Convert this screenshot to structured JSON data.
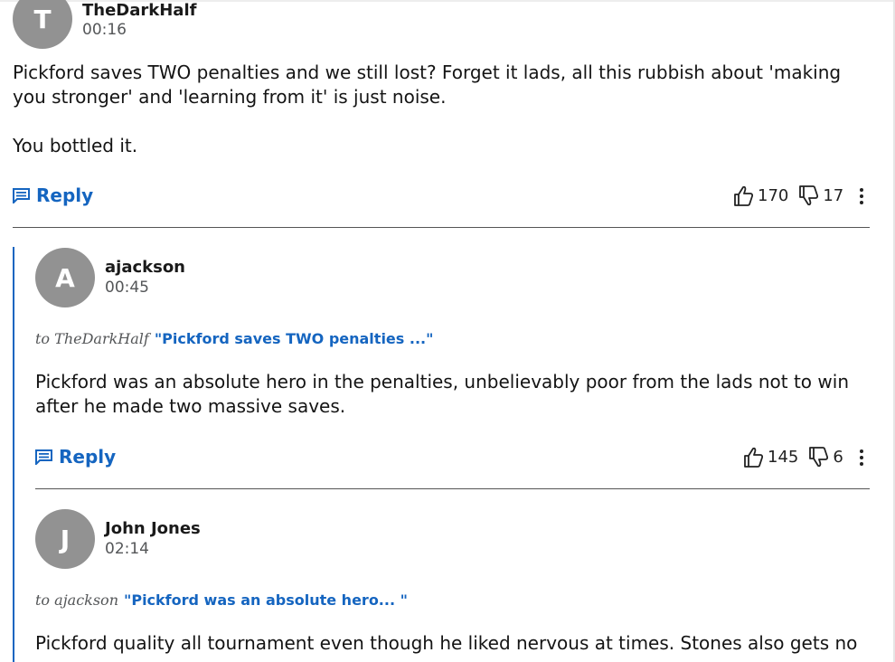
{
  "comments": [
    {
      "avatar_letter": "T",
      "username": "TheDarkHalf",
      "time": "00:16",
      "body": [
        "Pickford saves TWO penalties and we still lost? Forget it lads, all this rubbish about 'making you stronger' and 'learning from it' is just noise.",
        "You bottled it."
      ],
      "reply_label": "Reply",
      "upvotes": "170",
      "downvotes": "17"
    },
    {
      "avatar_letter": "A",
      "username": "ajackson",
      "time": "00:45",
      "reply_to_label": "to TheDarkHalf",
      "reply_to_quote": "\"Pickford saves TWO penalties ...\"",
      "body": [
        "Pickford was an absolute hero in the penalties, unbelievably poor from the lads not to win after he made two massive saves."
      ],
      "reply_label": "Reply",
      "upvotes": "145",
      "downvotes": "6"
    },
    {
      "avatar_letter": "J",
      "username": "John Jones",
      "time": "02:14",
      "reply_to_label": "to ajackson",
      "reply_to_quote": "\"Pickford was an absolute hero... \"",
      "body": [
        "Pickford quality all tournament even though he liked nervous at times. Stones also gets no"
      ]
    }
  ],
  "colors": {
    "accent": "#1565c0",
    "avatar": "#929292",
    "muted": "#545658"
  }
}
